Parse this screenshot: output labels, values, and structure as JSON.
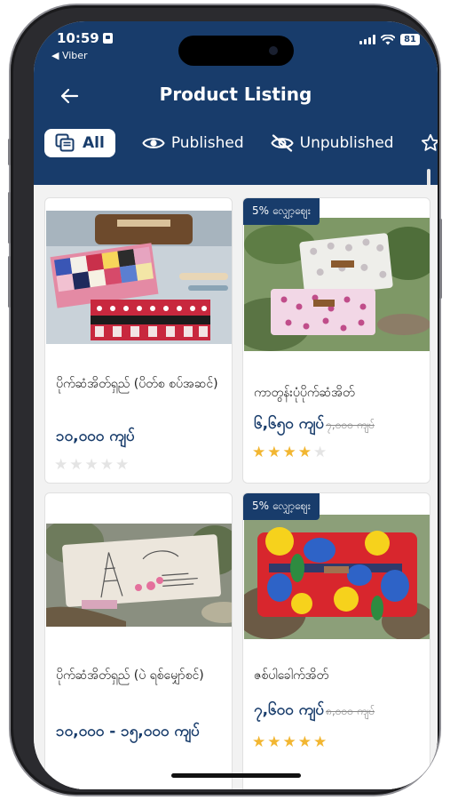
{
  "status_bar": {
    "time": "10:59",
    "back_app": "◀ Viber",
    "battery": "81"
  },
  "header": {
    "title": "Product Listing"
  },
  "tabs": [
    {
      "label": "All",
      "icon": "copy-icon",
      "active": true
    },
    {
      "label": "Published",
      "icon": "eye-icon",
      "active": false
    },
    {
      "label": "Unpublished",
      "icon": "eye-off-icon",
      "active": false
    }
  ],
  "products": [
    {
      "name": "ပိုက်ဆံအိတ်ရှည် (ပိတ်စ စပ်အဆင်)",
      "price": "၁၀,၀၀၀ ကျပ်",
      "old_price": "",
      "discount_badge": "",
      "rating": 0,
      "rating_max": 5
    },
    {
      "name": "ကာတွန်းပုံပိုက်ဆံအိတ်",
      "price": "၆,၆၅၀ ကျပ်",
      "old_price": "၇,၀၀၀ ကျပ်",
      "discount_badge": "5% လျှော့ဈေး",
      "rating": 4,
      "rating_max": 5
    },
    {
      "name": "ပိုက်ဆံအိတ်ရှည် (ပဲ ရစ်မျှော်စင်)",
      "price": "၁၀,၀၀၀ - ၁၅,၀၀၀ ကျပ်",
      "old_price": "",
      "discount_badge": "",
      "rating": 0,
      "rating_max": 5
    },
    {
      "name": "ဇစ်ပါခေါက်အိတ်",
      "price": "၇,၆၀၀ ကျပ်",
      "old_price": "၈,၀၀၀ ကျပ်",
      "discount_badge": "5% လျှော့ဈေး",
      "rating": 5,
      "rating_max": 5
    }
  ],
  "colors": {
    "primary": "#183c6b",
    "star": "#f2b631",
    "star_empty": "#e4e4e4"
  }
}
